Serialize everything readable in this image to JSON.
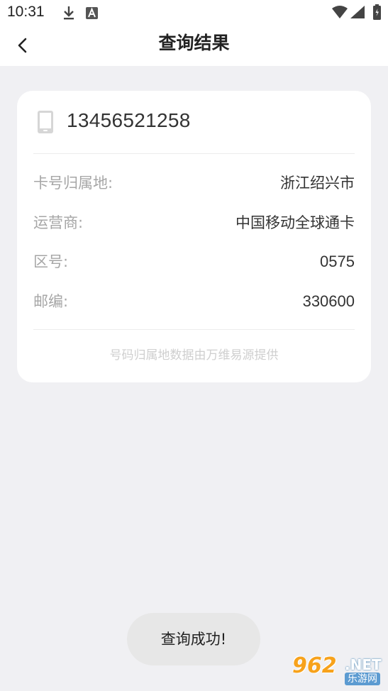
{
  "status_bar": {
    "time": "10:31",
    "icons": [
      "download-icon",
      "a-notification-icon",
      "wifi-icon",
      "signal-icon",
      "battery-icon"
    ]
  },
  "header": {
    "title": "查询结果",
    "back_icon": "chevron-left-icon"
  },
  "result": {
    "phone_icon": "phone-icon",
    "phone_number": "13456521258",
    "rows": [
      {
        "label": "卡号归属地:",
        "value": "浙江绍兴市"
      },
      {
        "label": "运营商:",
        "value": "中国移动全球通卡"
      },
      {
        "label": "区号:",
        "value": "0575"
      },
      {
        "label": "邮编:",
        "value": "330600"
      }
    ],
    "footnote": "号码归属地数据由万维易源提供"
  },
  "toast": {
    "text": "查询成功!"
  },
  "watermark": {
    "big": "962",
    "net": ".NET",
    "sub": "乐游网"
  },
  "colors": {
    "background": "#f0f0f3",
    "card": "#ffffff",
    "label": "#a6a6a6",
    "value": "#333333",
    "watermark_orange": "#f7a21b",
    "watermark_blue": "#5c9bd1"
  }
}
